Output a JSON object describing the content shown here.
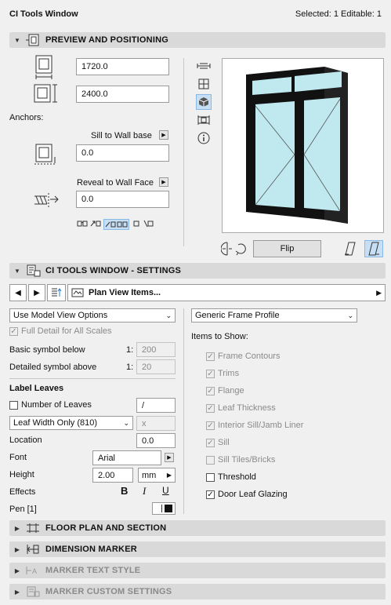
{
  "window": {
    "title": "CI Tools Window",
    "selection": "Selected: 1 Editable: 1"
  },
  "preview": {
    "section_label": "PREVIEW AND POSITIONING",
    "width_value": "1720.0",
    "height_value": "2400.0",
    "anchors_label": "Anchors:",
    "sill_label": "Sill to Wall base",
    "sill_value": "0.0",
    "reveal_label": "Reveal to Wall Face",
    "reveal_value": "0.0",
    "flip_label": "Flip"
  },
  "settings": {
    "section_label": "CI TOOLS WINDOW - SETTINGS",
    "panel_dropdown": "Plan View Items...",
    "view_options": "Use Model View Options",
    "full_detail": "Full Detail for All Scales",
    "basic_symbol_label": "Basic symbol below",
    "basic_symbol_prefix": "1:",
    "basic_symbol_value": "200",
    "detailed_symbol_label": "Detailed symbol above",
    "detailed_symbol_prefix": "1:",
    "detailed_symbol_value": "20",
    "label_leaves_heading": "Label Leaves",
    "number_of_leaves": "Number of Leaves",
    "leaves_separator": "/",
    "leaf_width_option": "Leaf Width Only (810)",
    "leaf_x": "x",
    "location_label": "Location",
    "location_value": "0.0",
    "font_label": "Font",
    "font_value": "Arial",
    "height_label": "Height",
    "height_value": "2.00",
    "height_unit": "mm",
    "effects_label": "Effects",
    "effect_bold": "B",
    "effect_italic": "I",
    "effect_underline": "U",
    "pen_label": "Pen [1]",
    "frame_profile": "Generic Frame Profile",
    "items_heading": "Items to Show:",
    "items": [
      {
        "label": "Frame Contours",
        "checked": true,
        "enabled": false
      },
      {
        "label": "Trims",
        "checked": true,
        "enabled": false
      },
      {
        "label": "Flange",
        "checked": true,
        "enabled": false
      },
      {
        "label": "Leaf Thickness",
        "checked": true,
        "enabled": false
      },
      {
        "label": "Interior Sill/Jamb Liner",
        "checked": true,
        "enabled": false
      },
      {
        "label": "Sill",
        "checked": true,
        "enabled": false
      },
      {
        "label": "Sill Tiles/Bricks",
        "checked": false,
        "enabled": false
      },
      {
        "label": "Threshold",
        "checked": false,
        "enabled": true
      },
      {
        "label": "Door Leaf Glazing",
        "checked": true,
        "enabled": true
      }
    ]
  },
  "sections": {
    "floor_plan": "FLOOR PLAN AND SECTION",
    "dimension_marker": "DIMENSION MARKER",
    "marker_text_style": "MARKER TEXT STYLE",
    "marker_custom": "MARKER CUSTOM SETTINGS"
  },
  "colors": {
    "accent": "#2a7fd4",
    "section_bg": "#d9d9d9",
    "glass": "#bfe9ef",
    "selected_tool": "#c7dff5"
  }
}
